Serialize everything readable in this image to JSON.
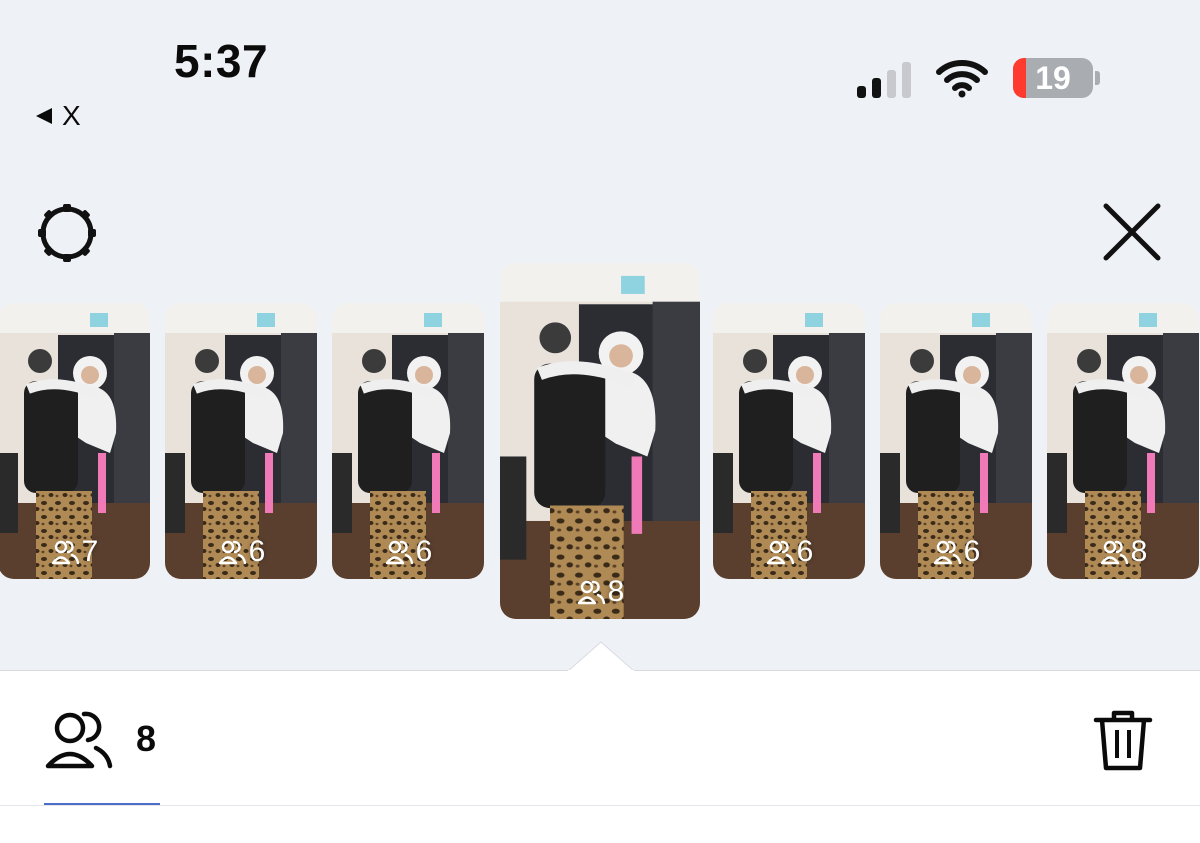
{
  "status_bar": {
    "time": "5:37",
    "back_app_label": "X",
    "battery_percent": "19",
    "battery_level": 0.19,
    "signal_bars_active": 2,
    "signal_bars_total": 4
  },
  "toolbar": {
    "settings_icon": "settings-gear-icon",
    "close_icon": "close-icon"
  },
  "filmstrip": {
    "selected_index": 3,
    "thumbnails": [
      {
        "count": "7"
      },
      {
        "count": "6"
      },
      {
        "count": "6"
      },
      {
        "count": "8"
      },
      {
        "count": "6"
      },
      {
        "count": "6"
      },
      {
        "count": "8"
      }
    ]
  },
  "detail": {
    "people_icon": "people-icon",
    "people_count": "8",
    "delete_icon": "trash-icon"
  },
  "colors": {
    "background": "#eef1f5",
    "panel": "#ffffff",
    "accent": "#4b6fc9",
    "battery_low": "#ff3b30"
  }
}
